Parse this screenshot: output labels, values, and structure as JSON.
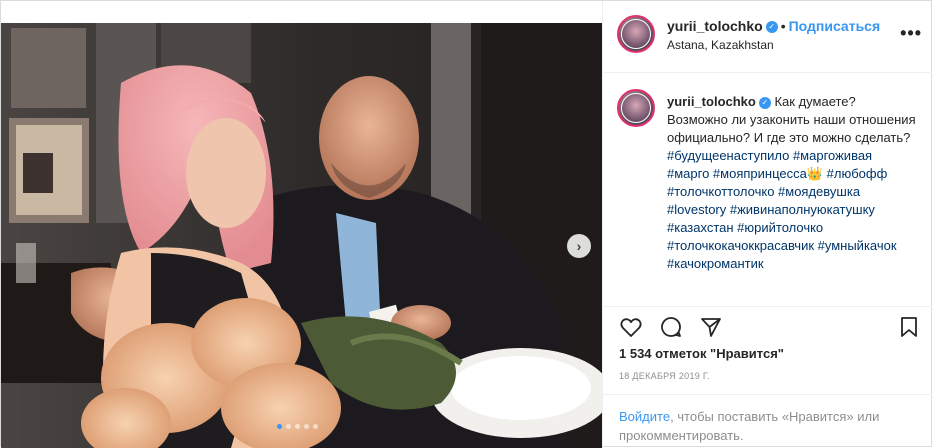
{
  "post": {
    "author": {
      "username": "yurii_tolochko",
      "verified_icon": "verified-badge-icon",
      "location": "Astana, Kazakhstan"
    },
    "header": {
      "separator": "•",
      "follow_label": "Подписаться",
      "more_label": "•••"
    },
    "caption": {
      "text": "Как думаете? Возможно ли узаконить наши отношения официально? И где это можно сделать?",
      "tags_1": "#будущеенаступило #маргоживая #марго #мояпринцесса",
      "crown_emoji": "👑",
      "tags_2": "#любофф #толочкоттолочко #моядевушка #lovestory #живинаполнуюкатушку #казахстан #юрийтолочко #толочкокачоккрасавчик #умныйкачок #качокромантик"
    },
    "actions": {
      "like_icon": "heart-icon",
      "comment_icon": "comment-icon",
      "share_icon": "share-icon",
      "save_icon": "bookmark-icon"
    },
    "likes": "1 534 отметок \"Нравится\"",
    "date": "18 декабря 2019 г.",
    "login": {
      "link": "Войдите",
      "rest": ", чтобы поставить «Нравится» или прокомментировать."
    },
    "carousel": {
      "next_label": "›",
      "total_slides": 5,
      "active_slide": 1
    }
  },
  "colors": {
    "accent": "#3897f0",
    "text": "#262626",
    "muted": "#8e8e8e",
    "hashtag": "#003569",
    "border": "#efefef"
  }
}
